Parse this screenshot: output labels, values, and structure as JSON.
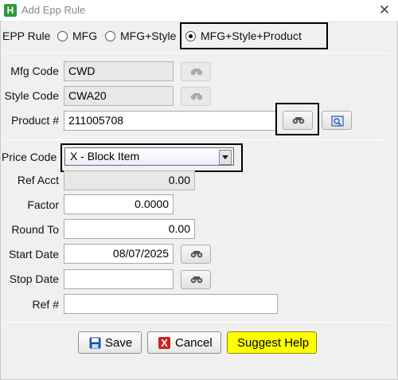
{
  "window": {
    "title": "Add Epp Rule",
    "app_icon_letter": "H",
    "close_glyph": "✕"
  },
  "epp_rule": {
    "label": "EPP Rule",
    "options": [
      {
        "label": "MFG",
        "selected": false
      },
      {
        "label": "MFG+Style",
        "selected": false
      },
      {
        "label": "MFG+Style+Product",
        "selected": true
      }
    ]
  },
  "fields": {
    "mfg_code": {
      "label": "Mfg Code",
      "value": "CWD",
      "readonly": true
    },
    "style_code": {
      "label": "Style Code",
      "value": "CWA20",
      "readonly": true
    },
    "product": {
      "label": "Product #",
      "value": "211005708"
    },
    "price_code": {
      "label": "Price Code",
      "value": "X - Block Item"
    },
    "ref_acct": {
      "label": "Ref Acct",
      "value": "0.00",
      "readonly": true
    },
    "factor": {
      "label": "Factor",
      "value": "0.0000"
    },
    "round_to": {
      "label": "Round To",
      "value": "0.00"
    },
    "start_date": {
      "label": "Start Date",
      "value": "08/07/2025"
    },
    "stop_date": {
      "label": "Stop Date",
      "value": ""
    },
    "ref_no": {
      "label": "Ref #",
      "value": ""
    }
  },
  "icons": {
    "lookup": "binoculars-icon",
    "browse": "magnifier-icon",
    "save": "floppy-disk-icon",
    "cancel": "red-x-icon"
  },
  "buttons": {
    "save": "Save",
    "cancel": "Cancel",
    "suggest_help": "Suggest Help"
  },
  "colors": {
    "suggest_bg": "#ffff00",
    "cancel_icon": "#d21f1f",
    "save_icon": "#1f4fa8",
    "highlight_box": "#000000"
  }
}
